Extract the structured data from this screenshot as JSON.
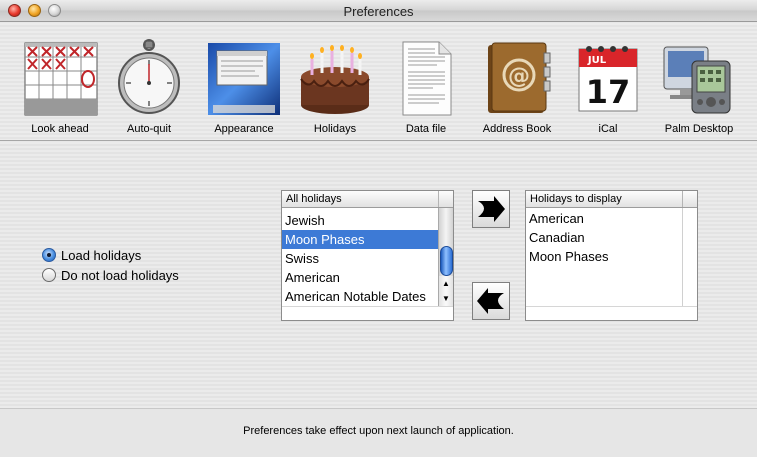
{
  "window": {
    "title": "Preferences"
  },
  "toolbar": {
    "items": [
      {
        "label": "Look ahead",
        "icon": "calendar-grid-icon"
      },
      {
        "label": "Auto-quit",
        "icon": "stopwatch-icon"
      },
      {
        "label": "Appearance",
        "icon": "desktop-screen-icon"
      },
      {
        "label": "Holidays",
        "icon": "birthday-cake-icon"
      },
      {
        "label": "Data file",
        "icon": "document-icon"
      },
      {
        "label": "Address Book",
        "icon": "address-book-icon"
      },
      {
        "label": "iCal",
        "icon": "ical-calendar-icon"
      },
      {
        "label": "Palm Desktop",
        "icon": "palm-device-icon"
      }
    ],
    "ical_month": "JUL",
    "ical_day": "17"
  },
  "load_options": {
    "load": "Load holidays",
    "dont_load": "Do not load holidays",
    "selected": "Load holidays"
  },
  "all_holidays": {
    "header": "All holidays",
    "items": [
      "Jewish",
      "Moon Phases",
      "Swiss",
      "American",
      "American Notable Dates"
    ],
    "selected": "Moon Phases"
  },
  "display_holidays": {
    "header": "Holidays to display",
    "items": [
      "American",
      "Canadian",
      "Moon Phases"
    ]
  },
  "footer": {
    "note": "Preferences take effect upon next launch of application."
  },
  "colors": {
    "selection": "#3d7ad6",
    "scroll_thumb": "#2c6fd4"
  }
}
